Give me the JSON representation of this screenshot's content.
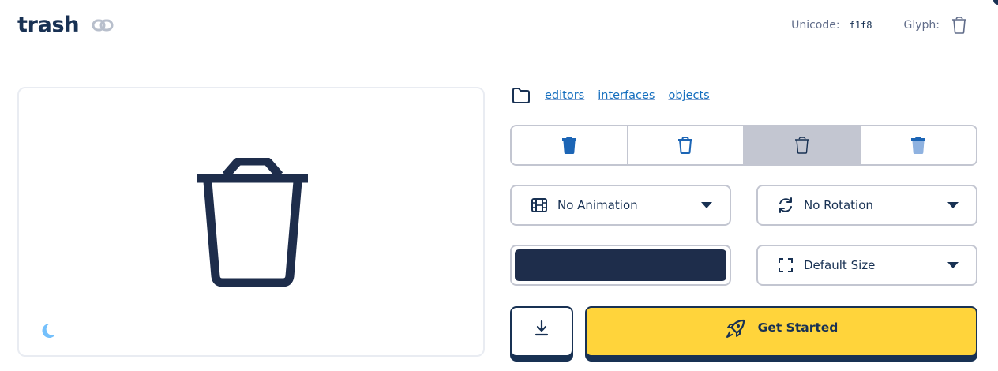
{
  "icon": {
    "name": "trash"
  },
  "meta": {
    "unicode_label": "Unicode:",
    "unicode_value": "f1f8",
    "glyph_label": "Glyph:"
  },
  "categories": [
    "editors",
    "interfaces",
    "objects"
  ],
  "styles": [
    {
      "icon": "trash-solid-icon"
    },
    {
      "icon": "trash-regular-icon"
    },
    {
      "icon": "trash-light-icon",
      "selected": true
    },
    {
      "icon": "trash-duotone-icon"
    }
  ],
  "controls": {
    "animation": "No Animation",
    "rotation": "No Rotation",
    "size": "Default Size"
  },
  "color": {
    "value": "#1e2d4b"
  },
  "actions": {
    "get_started": "Get Started"
  },
  "theme": {
    "navy": "#183153",
    "brand_yellow": "#ffd43b",
    "link_blue": "#146ebe",
    "border": "#c3c6d1",
    "accent_light_blue": "#74c0fc",
    "duotone_blue": "#8fb2e0",
    "primary_blue": "#1c65b5"
  }
}
